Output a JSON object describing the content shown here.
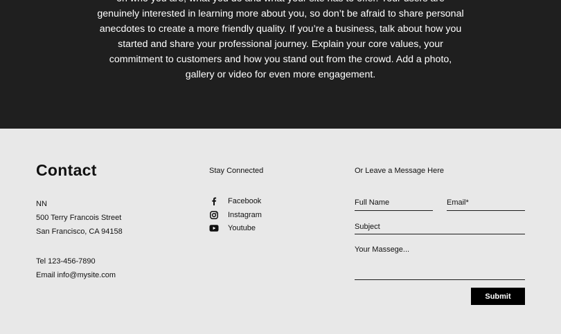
{
  "about": {
    "lines": [
      "on who you are, what you do and what your site has to offer. Your users are",
      "genuinely interested in learning more about you, so don’t be afraid to share personal",
      "anecdotes to create a more friendly quality. If you’re a business, talk about how you",
      "started and share your professional journey. Explain your core values, your",
      "commitment to customers and how you stand out from the crowd. Add a photo,",
      "gallery or video for even more engagement."
    ]
  },
  "contact": {
    "title": "Contact",
    "name": "NN",
    "street": "500 Terry Francois Street",
    "city": "San Francisco, CA 94158",
    "tel": "Tel 123-456-7890",
    "email": "Email info@mysite.com"
  },
  "social": {
    "title": "Stay Connected",
    "items": [
      {
        "label": "Facebook",
        "icon": "facebook-icon"
      },
      {
        "label": "Instagram",
        "icon": "instagram-icon"
      },
      {
        "label": "Youtube",
        "icon": "youtube-icon"
      }
    ]
  },
  "form": {
    "title": "Or Leave a Message Here",
    "full_name_placeholder": "Full Name",
    "email_placeholder": "Email*",
    "subject_placeholder": "Subject",
    "message_placeholder": "Your Massege...",
    "submit_label": "Submit"
  },
  "colors": {
    "dark_section": "#1f1f1f",
    "footer_bg": "#e8e8e8",
    "button_bg": "#000000"
  }
}
